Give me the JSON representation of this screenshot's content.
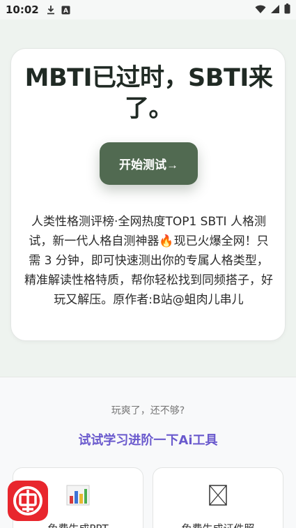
{
  "status_bar": {
    "time": "10:02",
    "left_icons": [
      "download-icon",
      "a-box-icon"
    ],
    "right_icons": [
      "wifi-icon",
      "signal-icon",
      "battery-icon"
    ]
  },
  "hero": {
    "title": "MBTI已过时，SBTI来了。",
    "start_button": "开始测试→",
    "description": "人类性格测评榜·全网热度TOP1 SBTI 人格测试，新一代人格自测神器🔥现已火爆全网！只需 3 分钟，即可快速测出你的专属人格类型，精准解读性格特质，帮你轻松找到同频搭子，好玩又解压。原作者:B站@蛆肉儿串儿"
  },
  "promo": {
    "subtitle": "玩爽了，还不够?",
    "link": "试试学习进阶一下Ai工具"
  },
  "tools": [
    {
      "label": "免费生成PPT",
      "icon": "bar-chart-icon"
    },
    {
      "label": "免费生成证件照",
      "icon": "image-placeholder-icon"
    }
  ],
  "floating_app": {
    "icon": "app-logo-icon"
  },
  "colors": {
    "accent_green": "#516a51",
    "link_purple": "#6a5acd",
    "logo_red": "#e8262d"
  }
}
